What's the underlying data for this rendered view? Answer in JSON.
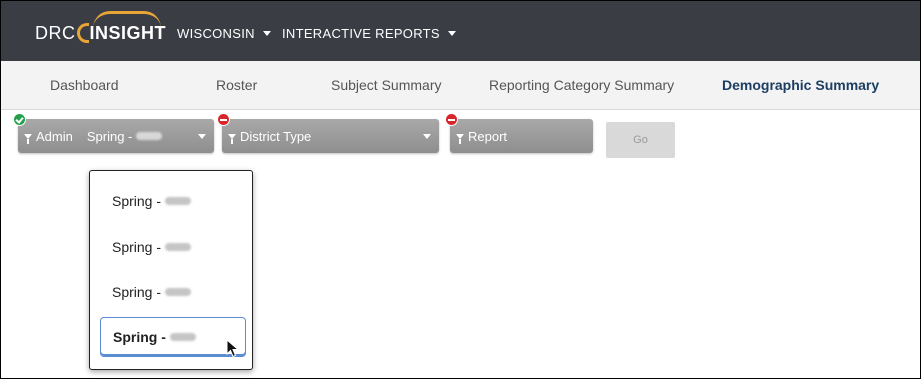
{
  "brand": {
    "drc": "DRC",
    "insight": "INSIGHT"
  },
  "topnav": [
    {
      "label": "WISCONSIN"
    },
    {
      "label": "INTERACTIVE REPORTS"
    }
  ],
  "tabs": [
    {
      "label": "Dashboard"
    },
    {
      "label": "Roster"
    },
    {
      "label": "Subject Summary"
    },
    {
      "label": "Reporting Category Summary"
    },
    {
      "label": "Demographic Summary",
      "active": true
    }
  ],
  "filters": {
    "admin": {
      "label": "Admin",
      "value_prefix": "Spring -",
      "status": "ok"
    },
    "district_type": {
      "label": "District Type",
      "status": "error"
    },
    "report": {
      "label": "Report",
      "status": "error"
    },
    "go_label": "Go"
  },
  "dropdown": {
    "options": [
      {
        "label": "Spring -"
      },
      {
        "label": "Spring -"
      },
      {
        "label": "Spring -"
      },
      {
        "label": "Spring -",
        "selected": true
      }
    ]
  },
  "icons": {
    "filter": "funnel-icon",
    "caret": "chevron-down-icon",
    "ok": "check-circle-icon",
    "error": "minus-circle-icon",
    "cursor": "mouse-pointer-icon"
  },
  "colors": {
    "topbar": "#3a3d44",
    "accent_logo": "#e8a637",
    "active_tab": "#1c3e63",
    "ok": "#22a04a",
    "error": "#d9262b",
    "selection": "#5b8bd0"
  }
}
